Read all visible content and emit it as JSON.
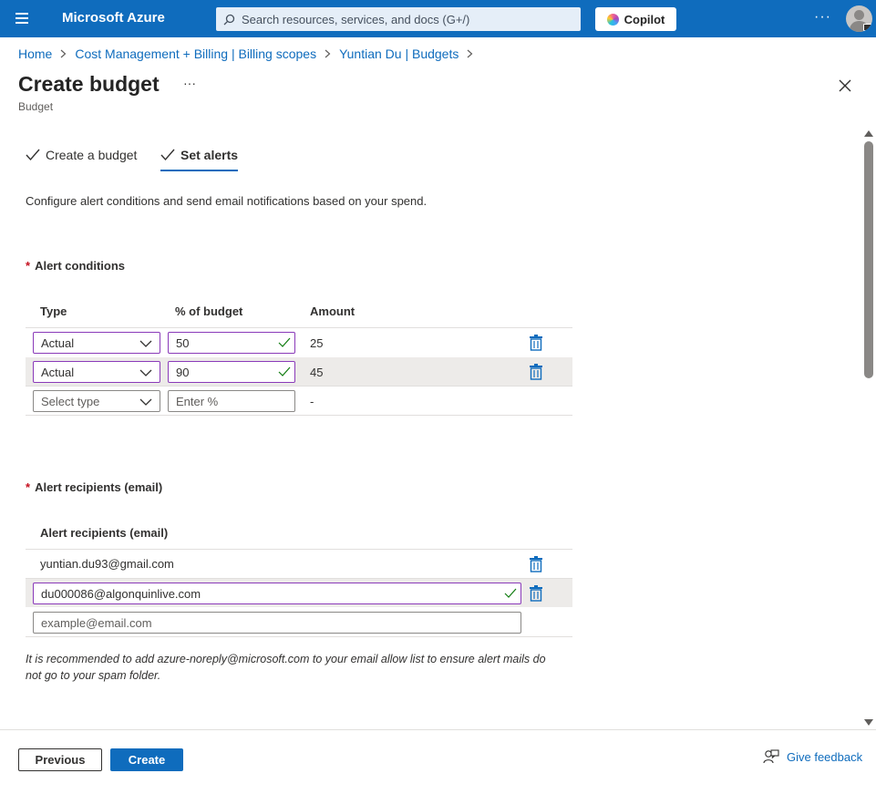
{
  "topbar": {
    "brand": "Microsoft Azure",
    "search_placeholder": "Search resources, services, and docs (G+/)",
    "copilot_label": "Copilot",
    "more_label": "···"
  },
  "breadcrumb": [
    {
      "label": "Home"
    },
    {
      "label": "Cost Management + Billing | Billing scopes"
    },
    {
      "label": "Yuntian Du | Budgets"
    }
  ],
  "page": {
    "title": "Create budget",
    "more_label": "···",
    "subtitle": "Budget"
  },
  "tabs": [
    {
      "label": "Create a budget",
      "active": false,
      "completed": true
    },
    {
      "label": "Set alerts",
      "active": true,
      "completed": true
    }
  ],
  "description": "Configure alert conditions and send email notifications based on your spend.",
  "alert_conditions": {
    "title": "Alert conditions",
    "required_marker": "*",
    "columns": {
      "type": "Type",
      "percent": "% of budget",
      "amount": "Amount"
    },
    "rows": [
      {
        "type": "Actual",
        "percent": "50",
        "amount": "25"
      },
      {
        "type": "Actual",
        "percent": "90",
        "amount": "45"
      }
    ],
    "new_row": {
      "type_placeholder": "Select type",
      "percent_placeholder": "Enter %",
      "amount": "-"
    }
  },
  "alert_recipients": {
    "title": "Alert recipients (email)",
    "required_marker": "*",
    "column": "Alert recipients (email)",
    "emails": [
      "yuntian.du93@gmail.com",
      "du000086@algonquinlive.com"
    ],
    "new_placeholder": "example@email.com"
  },
  "note": "It is recommended to add azure-noreply@microsoft.com to your email allow list to ensure alert mails do not go to your spam folder.",
  "footer": {
    "previous_label": "Previous",
    "create_label": "Create",
    "feedback_label": "Give feedback"
  },
  "colors": {
    "brand_blue": "#0f6cbd",
    "valid_border": "#8a3ab9",
    "valid_check": "#107c10",
    "required": "#c50f1f"
  }
}
